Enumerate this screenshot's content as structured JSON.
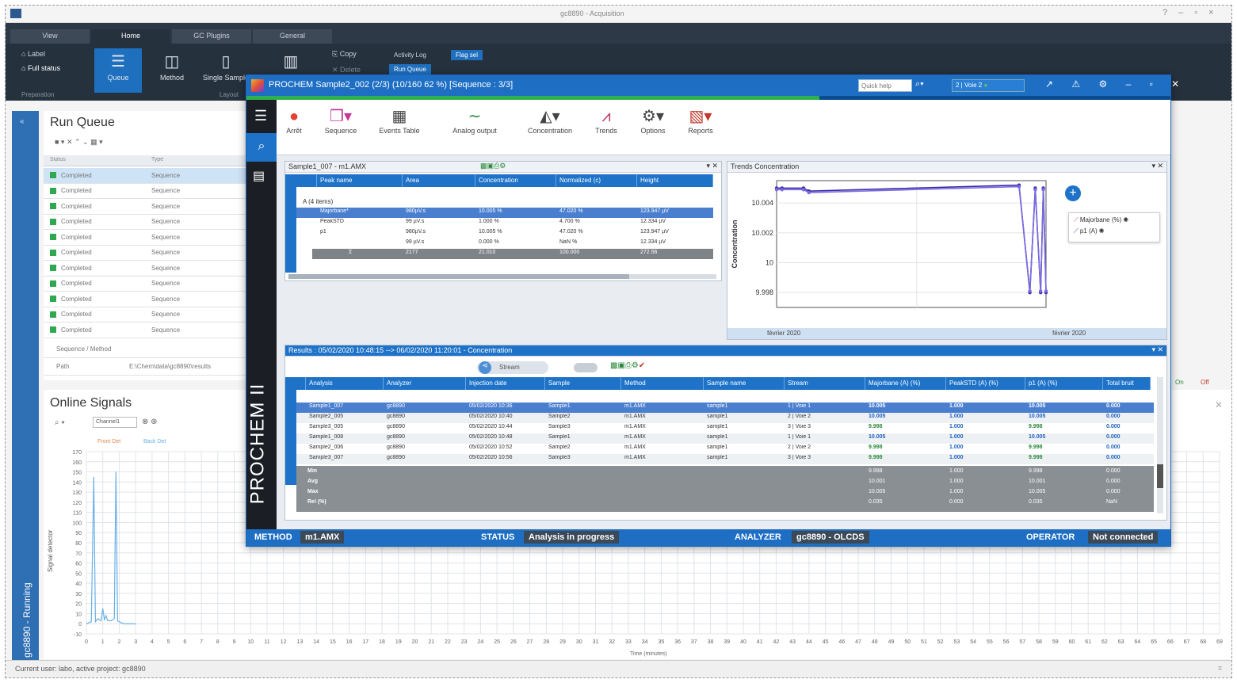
{
  "window": {
    "title": "gc8890 - Acquisition"
  },
  "tabs": [
    "View",
    "Home",
    "GC Plugins",
    "General"
  ],
  "ribbon": {
    "small_left": [
      "Label",
      "Full status"
    ],
    "big_buttons": [
      "Queue",
      "Method",
      "Single Sample"
    ],
    "copy": "Copy",
    "delete": "Delete",
    "activity_log": "Activity Log",
    "run_queue": "Run Queue",
    "flag": "Flag sel",
    "group_left": "Preparation",
    "group_mid": "Layout"
  },
  "run_queue": {
    "title": "Run Queue",
    "headers": [
      "Status",
      "Type"
    ],
    "rows": [
      [
        "Completed",
        "Sequence"
      ],
      [
        "Completed",
        "Sequence"
      ],
      [
        "Completed",
        "Sequence"
      ],
      [
        "Completed",
        "Sequence"
      ],
      [
        "Completed",
        "Sequence"
      ],
      [
        "Completed",
        "Sequence"
      ],
      [
        "Completed",
        "Sequence"
      ],
      [
        "Completed",
        "Sequence"
      ],
      [
        "Completed",
        "Sequence"
      ],
      [
        "Completed",
        "Sequence"
      ],
      [
        "Completed",
        "Sequence"
      ]
    ],
    "meta": [
      [
        "Sequence / Method",
        ""
      ],
      [
        "Path",
        "E:\\Chem\\data\\gc8890\\results"
      ]
    ]
  },
  "left_strip": {
    "label": "gc8890 - Running"
  },
  "online_signals": {
    "title": "Online Signals",
    "select": "Channel1",
    "legend": [
      "Front Det",
      "Back Det"
    ],
    "ylabel": "Signal detector",
    "xlabel": "Time (minutes)",
    "y_ticks": [
      "170",
      "160",
      "150",
      "140",
      "130",
      "120",
      "110",
      "100",
      "90",
      "80",
      "70",
      "60",
      "50",
      "40",
      "30",
      "20",
      "10",
      "0",
      "-10"
    ],
    "x_ticks": [
      "0",
      "1",
      "2",
      "3",
      "4",
      "5",
      "6",
      "7",
      "8",
      "9",
      "10",
      "11",
      "12",
      "13",
      "14",
      "15",
      "16",
      "17",
      "18",
      "19",
      "20",
      "21",
      "22",
      "23",
      "24",
      "25",
      "26",
      "27",
      "28",
      "29",
      "30",
      "31",
      "32",
      "33",
      "34",
      "35",
      "36",
      "37",
      "38",
      "39",
      "40",
      "41",
      "42",
      "43",
      "44",
      "45",
      "46",
      "47",
      "48",
      "49",
      "50",
      "51",
      "52",
      "53",
      "54",
      "55",
      "56",
      "57",
      "58",
      "59",
      "60",
      "61",
      "62",
      "63",
      "64",
      "65",
      "66",
      "67",
      "68",
      "69"
    ],
    "on": "On",
    "off": "Off"
  },
  "status_bar": {
    "text": "Current user: labo, active project: gc8890"
  },
  "prochem": {
    "title": "PROCHEM  Sample2_002 (2/3) (10/160 62 %) [Sequence : 3/3]",
    "search_placeholder": "Quick help",
    "stream_select": "2 | Voie 2",
    "brand": "PROCHEM II",
    "progress_pct": 62,
    "toolbar": [
      "Arrêt",
      "Sequence",
      "Events Table",
      "Analog output",
      "Concentration",
      "Trends",
      "Options",
      "Reports"
    ],
    "peaks": {
      "title": "Sample1_007 - m1.AMX",
      "headers": [
        "Peak name",
        "Area",
        "Concentration",
        "Normalized (c)",
        "Height"
      ],
      "group": "A (4 items)",
      "rows": [
        [
          "Majorbane*",
          "980µV.s",
          "10.005 %",
          "47.020 %",
          "123.947 µV"
        ],
        [
          "PeakSTD",
          "99 µV.s",
          "1.000 %",
          "4.700 %",
          "12.334 µV"
        ],
        [
          "p1",
          "980µV.s",
          "10.005 %",
          "47.020 %",
          "123.947 µV"
        ],
        [
          "",
          "99 µV.s",
          "0.000 %",
          "NaN %",
          "12.334 µV"
        ]
      ],
      "total": [
        "Σ",
        "2177",
        "21.010",
        "100.000",
        "272.56"
      ]
    },
    "trends": {
      "title": "Trends Concentration",
      "legend": [
        "Majorbane (%)",
        "p1 (A)"
      ],
      "footer": [
        "février 2020",
        "février 2020"
      ]
    },
    "results": {
      "title": "Results : 05/02/2020 10:48:15 --> 06/02/2020 11:20:01 - Concentration",
      "stream_btn": "Stream",
      "headers": [
        "Analysis",
        "Analyzer",
        "Injection date",
        "Sample",
        "Method",
        "Sample name",
        "Stream",
        "Majorbane (A) (%)",
        "PeakSTD (A) (%)",
        "p1 (A) (%)",
        "Total bruit"
      ],
      "rows": [
        [
          "Sample1_007",
          "gc8890",
          "05/02/2020 10:36",
          "Sample1",
          "m1.AMX",
          "sample1",
          "1 | Voie 1",
          "10.005",
          "1.000",
          "10.005",
          "0.000"
        ],
        [
          "Sample2_005",
          "gc8890",
          "05/02/2020 10:40",
          "Sample2",
          "m1.AMX",
          "sample1",
          "2 | Voie 2",
          "10.005",
          "1.000",
          "10.005",
          "0.000"
        ],
        [
          "Sample3_005",
          "gc8890",
          "05/02/2020 10:44",
          "Sample3",
          "m1.AMX",
          "sample1",
          "3 | Voie 3",
          "9.998",
          "1.000",
          "9.998",
          "0.000"
        ],
        [
          "Sample1_008",
          "gc8890",
          "05/02/2020 10:48",
          "Sample1",
          "m1.AMX",
          "sample1",
          "1 | Voie 1",
          "10.005",
          "1.000",
          "10.005",
          "0.000"
        ],
        [
          "Sample2_006",
          "gc8890",
          "05/02/2020 10:52",
          "Sample2",
          "m1.AMX",
          "sample1",
          "2 | Voie 2",
          "9.998",
          "1.000",
          "9.998",
          "0.000"
        ],
        [
          "Sample3_007",
          "gc8890",
          "05/02/2020 10:56",
          "Sample3",
          "m1.AMX",
          "sample1",
          "3 | Voie 3",
          "9.998",
          "1.000",
          "9.998",
          "0.000"
        ]
      ],
      "summary": [
        [
          "Min",
          "9.998",
          "1.000",
          "9.998",
          "0.000"
        ],
        [
          "Avg",
          "10.001",
          "1.000",
          "10.001",
          "0.000"
        ],
        [
          "Max",
          "10.005",
          "1.000",
          "10.005",
          "0.000"
        ],
        [
          "Rel (%)",
          "0.035",
          "0.000",
          "0.035",
          "NaN"
        ]
      ]
    },
    "status": {
      "method_label": "METHOD",
      "method": "m1.AMX",
      "status_label": "STATUS",
      "status": "Analysis in progress",
      "analyzer_label": "ANALYZER",
      "analyzer": "gc8890 - OLCDS",
      "operator_label": "OPERATOR",
      "operator": "Not connected"
    }
  },
  "chart_data": {
    "type": "line",
    "title": "Trends Concentration",
    "ylabel": "Concentration",
    "y_ticks": [
      "10.004",
      "10.002",
      "10",
      "9.998"
    ],
    "ylim": [
      9.997,
      10.0055
    ],
    "series": [
      {
        "name": "Majorbane (%)",
        "color": "#3a2ca8",
        "x": [
          0,
          0.02,
          0.1,
          0.12,
          0.9,
          0.94,
          0.96,
          0.98,
          0.99,
          1.0
        ],
        "values": [
          10.005,
          10.005,
          10.005,
          10.0048,
          10.0052,
          9.998,
          10.005,
          9.998,
          10.005,
          9.998
        ]
      },
      {
        "name": "p1 (A)",
        "color": "#7a6be0",
        "x": [
          0,
          0.02,
          0.1,
          0.12,
          0.9,
          0.94,
          0.96,
          0.98,
          0.99,
          1.0
        ],
        "values": [
          10.0049,
          10.0049,
          10.0049,
          10.0047,
          10.0051,
          9.9981,
          10.0049,
          9.9981,
          10.0049,
          9.9981
        ]
      }
    ],
    "grid": true
  },
  "signal_data": {
    "type": "line",
    "xlim": [
      0,
      69
    ],
    "ylim": [
      -10,
      170
    ],
    "series": [
      {
        "name": "Front Det",
        "color": "#6ab0e8",
        "x": [
          0,
          0.3,
          0.45,
          0.55,
          0.7,
          0.9,
          1.0,
          1.1,
          1.2,
          1.3,
          1.5,
          1.7,
          1.8,
          1.9,
          2.0,
          2.1,
          2.3,
          3
        ],
        "values": [
          0,
          2,
          145,
          2,
          5,
          3,
          15,
          4,
          8,
          3,
          3,
          5,
          150,
          3,
          2,
          1,
          0,
          0
        ]
      }
    ]
  }
}
